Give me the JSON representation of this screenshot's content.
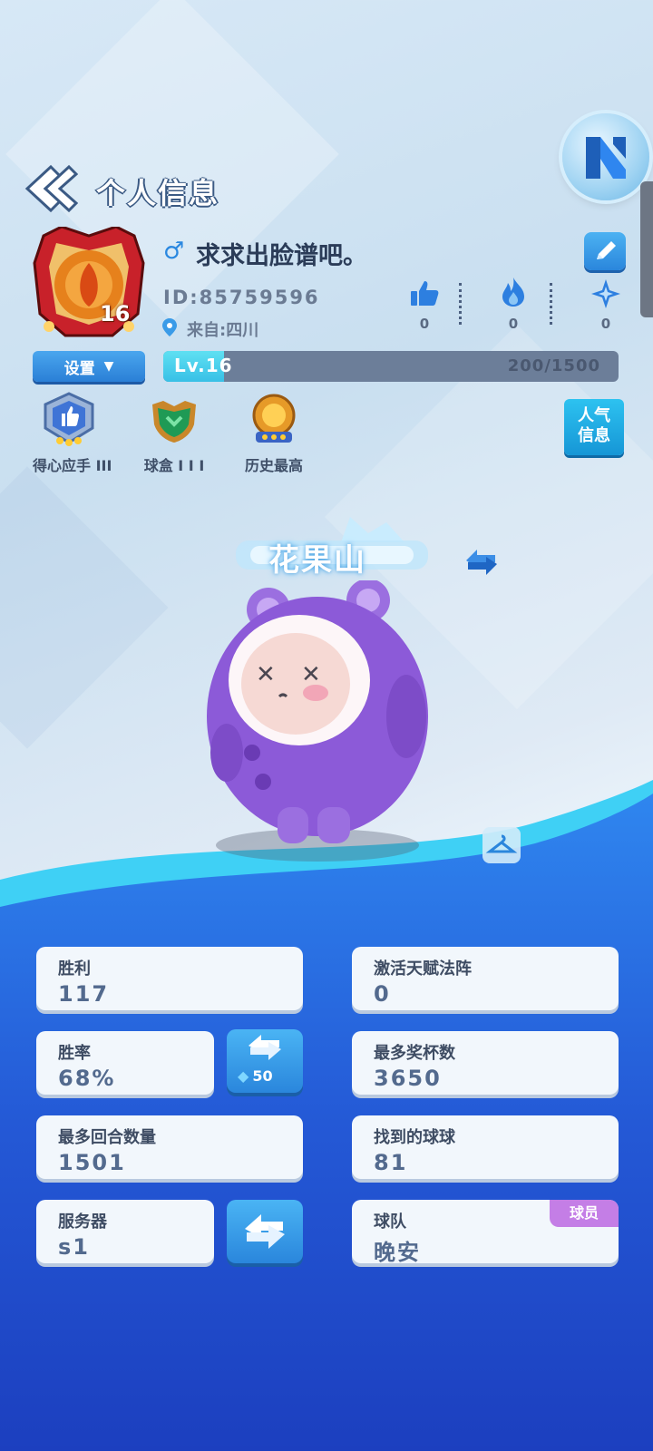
{
  "header": {
    "title": "个人信息"
  },
  "profile": {
    "avatar_level": "16",
    "gender_symbol": "♂",
    "username": "求求出脸谱吧。",
    "id_text": "ID:85759596",
    "location": "来自:四川",
    "settings_label": "设置",
    "stats": [
      {
        "icon": "thumbs-up-icon",
        "value": "0"
      },
      {
        "icon": "flame-icon",
        "value": "0"
      },
      {
        "icon": "sparkle-star-icon",
        "value": "0"
      }
    ],
    "level_label": "Lv.16",
    "exp_text": "200/1500",
    "exp_progress": 0.133
  },
  "badges": [
    {
      "icon": "thumbs-up-shield-icon",
      "label": "得心应手 III"
    },
    {
      "icon": "green-shield-icon",
      "label": "球盒 I I I"
    },
    {
      "icon": "gold-medal-icon",
      "label": "历史最高"
    }
  ],
  "popularity_button": {
    "line1": "人气",
    "line2": "信息"
  },
  "title_banner": "花果山",
  "stats_cards": {
    "wins": {
      "label": "胜利",
      "value": "117"
    },
    "talent": {
      "label": "激活天赋法阵",
      "value": "0"
    },
    "win_rate": {
      "label": "胜率",
      "value": "68%"
    },
    "reset_cost": "50",
    "trophies": {
      "label": "最多奖杯数",
      "value": "3650"
    },
    "rounds": {
      "label": "最多回合数量",
      "value": "1501"
    },
    "balls": {
      "label": "找到的球球",
      "value": "81"
    },
    "server": {
      "label": "服务器",
      "value": "s1"
    },
    "team": {
      "label": "球队",
      "value": "晚安",
      "tag": "球员"
    }
  },
  "colors": {
    "accent_blue": "#2a86dc",
    "bg_blue": "#2563d8",
    "player_tag": "#c47ee6"
  }
}
